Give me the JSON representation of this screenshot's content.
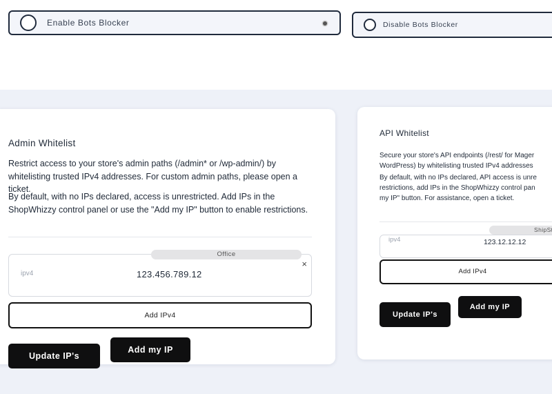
{
  "bots_blocker": {
    "enable_label": "Enable Bots Blocker",
    "disable_label": "Disable Bots Blocker"
  },
  "admin_whitelist": {
    "title": "Admin Whitelist",
    "paragraph1": "Restrict access to your store's admin paths (/admin* or /wp-admin/) by whitelisting trusted IPv4 addresses. For custom admin paths, please open a ticket.",
    "paragraph2": "By default, with no IPs declared, access is unrestricted. Add IPs in the ShopWhizzy control panel or use the \"Add my IP\" button to enable restrictions.",
    "ip_placeholder": "ipv4",
    "ip_value": "123.456.789.12",
    "ip_tag": "Office",
    "add_ipv4_label": "Add IPv4",
    "update_label": "Update IP's",
    "add_my_ip_label": "Add my IP"
  },
  "api_whitelist": {
    "title": "API Whitelist",
    "paragraph1_line1": "Secure your store's API endpoints (/rest/ for Mager",
    "paragraph1_line2": "WordPress) by whitelisting trusted IPv4 addresses",
    "paragraph2_line1": "By default, with no IPs declared, API access is unre",
    "paragraph2_line2": "restrictions, add IPs in the ShopWhizzy control pan",
    "paragraph2_line3": "my IP\" button. For assistance, open a ticket.",
    "ip_placeholder": "ipv4",
    "ip_value": "123.12.12.12",
    "ip_tag": "ShipSta",
    "add_ipv4_label": "Add IPv4",
    "update_label": "Update IP's",
    "add_my_ip_label": "Add my IP"
  },
  "icons": {
    "close": "×"
  }
}
